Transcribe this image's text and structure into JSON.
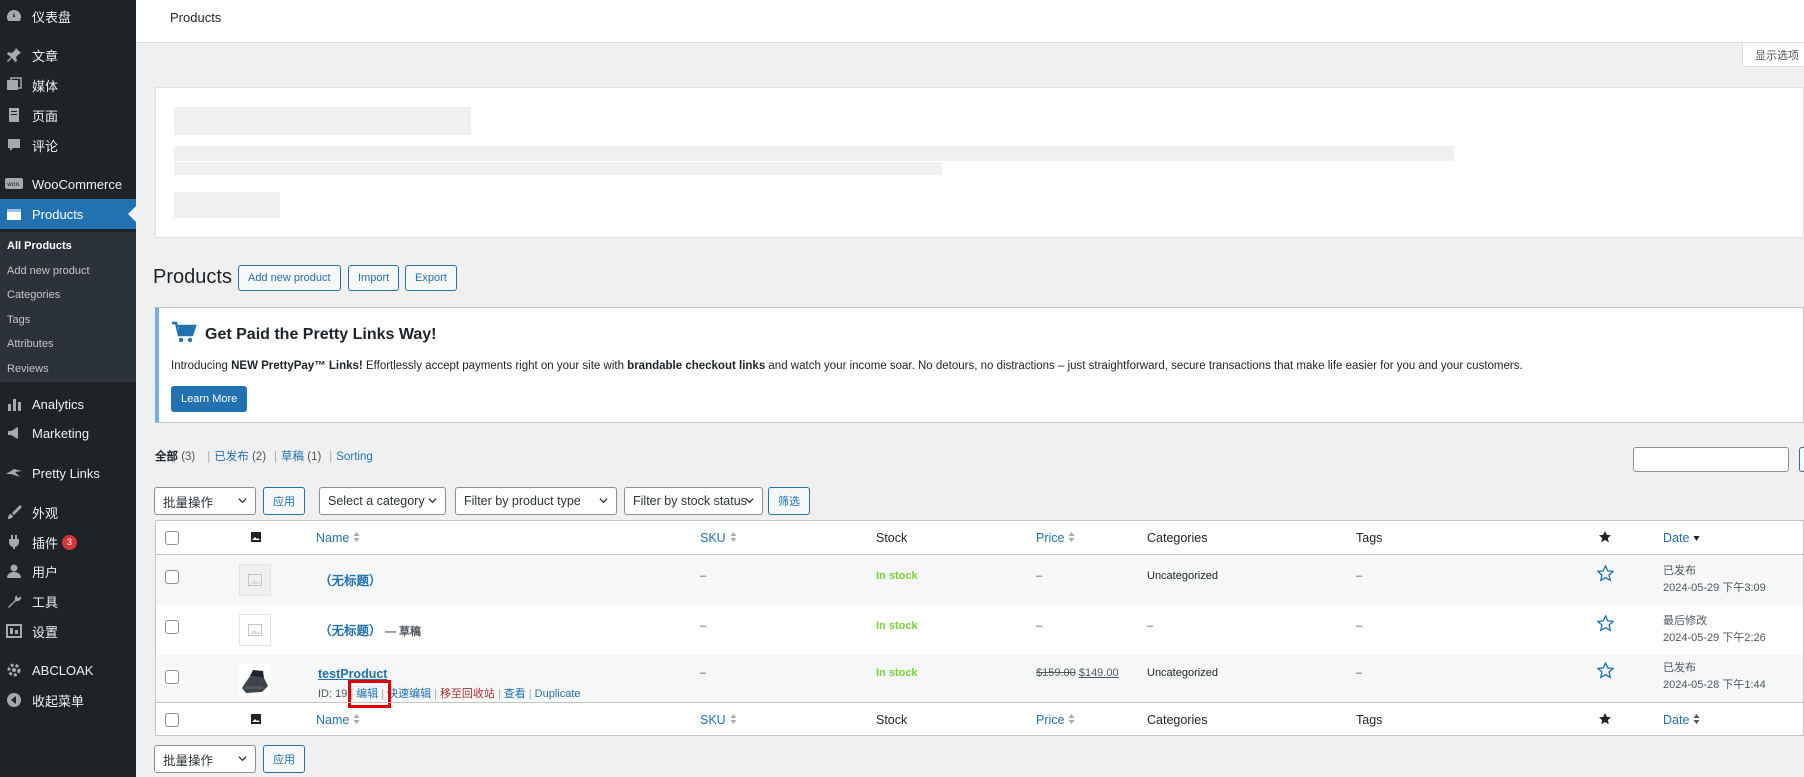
{
  "sidebar": {
    "items": [
      {
        "label": "仪表盘",
        "icon": "dashboard-icon"
      },
      {
        "label": "文章",
        "icon": "pin-icon"
      },
      {
        "label": "媒体",
        "icon": "media-icon"
      },
      {
        "label": "页面",
        "icon": "page-icon"
      },
      {
        "label": "评论",
        "icon": "comment-icon"
      },
      {
        "label": "WooCommerce",
        "icon": "woo-icon"
      },
      {
        "label": "Products",
        "icon": "products-icon"
      },
      {
        "label": "Analytics",
        "icon": "analytics-icon"
      },
      {
        "label": "Marketing",
        "icon": "megaphone-icon"
      },
      {
        "label": "Pretty Links",
        "icon": "pretty-links-icon"
      },
      {
        "label": "外观",
        "icon": "brush-icon"
      },
      {
        "label": "插件",
        "icon": "plugin-icon",
        "badge": "3"
      },
      {
        "label": "用户",
        "icon": "user-icon"
      },
      {
        "label": "工具",
        "icon": "wrench-icon"
      },
      {
        "label": "设置",
        "icon": "settings-icon"
      },
      {
        "label": "ABCLOAK",
        "icon": "gear-icon"
      },
      {
        "label": "收起菜单",
        "icon": "collapse-icon"
      }
    ],
    "submenu": [
      "All Products",
      "Add new product",
      "Categories",
      "Tags",
      "Attributes",
      "Reviews"
    ]
  },
  "topbar": {
    "title": "Products",
    "screen_options": "显示选项"
  },
  "heading": {
    "title": "Products",
    "add_new": "Add new product",
    "import": "Import",
    "export": "Export"
  },
  "notice": {
    "title": "Get Paid the Pretty Links Way!",
    "text_1": "Introducing ",
    "text_bold_1": "NEW PrettyPay™ Links!",
    "text_2": " Effortlessly accept payments right on your site with ",
    "text_bold_2": "brandable checkout links",
    "text_3": " and watch your income soar. No detours, no distractions – just straightforward, secure transactions that make life easier for you and your customers.",
    "button": "Learn More"
  },
  "views": {
    "all": "全部",
    "all_count": "(3)",
    "published": "已发布",
    "published_count": "(2)",
    "draft": "草稿",
    "draft_count": "(1)",
    "sorting": "Sorting"
  },
  "filters": {
    "bulk_action": "批量操作",
    "apply": "应用",
    "category": "Select a category",
    "product_type": "Filter by product type",
    "stock_status": "Filter by stock status",
    "filter": "筛选"
  },
  "table": {
    "columns": {
      "name": "Name",
      "sku": "SKU",
      "stock": "Stock",
      "price": "Price",
      "categories": "Categories",
      "tags": "Tags",
      "date": "Date"
    },
    "rows": [
      {
        "name": "（无标题）",
        "state": "",
        "sku": "–",
        "stock": "In stock",
        "price": "–",
        "price_old": "",
        "price_new": "",
        "category": "Uncategorized",
        "tags": "–",
        "date_status": "已发布",
        "date_value": "2024-05-29 下午3:09"
      },
      {
        "name": "（无标题）",
        "state": "— 草稿",
        "sku": "–",
        "stock": "In stock",
        "price": "–",
        "price_old": "",
        "price_new": "",
        "category": "–",
        "tags": "–",
        "date_status": "最后修改",
        "date_value": "2024-05-29 下午2:26"
      },
      {
        "name": "testProduct",
        "state": "",
        "sku": "–",
        "stock": "In stock",
        "price": "",
        "price_old": "$159.00",
        "price_new": "$149.00",
        "category": "Uncategorized",
        "tags": "–",
        "date_status": "已发布",
        "date_value": "2024-05-28 下午1:44",
        "id_label": "ID: 19",
        "actions": {
          "edit": "编辑",
          "quick_edit": "快速编辑",
          "trash": "移至回收站",
          "view": "查看",
          "duplicate": "Duplicate"
        }
      }
    ]
  },
  "colors": {
    "admin_bar": "#1d2327",
    "accent": "#2271b1",
    "in_stock": "#7ad03a",
    "trash": "#b32d2e",
    "highlight": "#e00000"
  }
}
